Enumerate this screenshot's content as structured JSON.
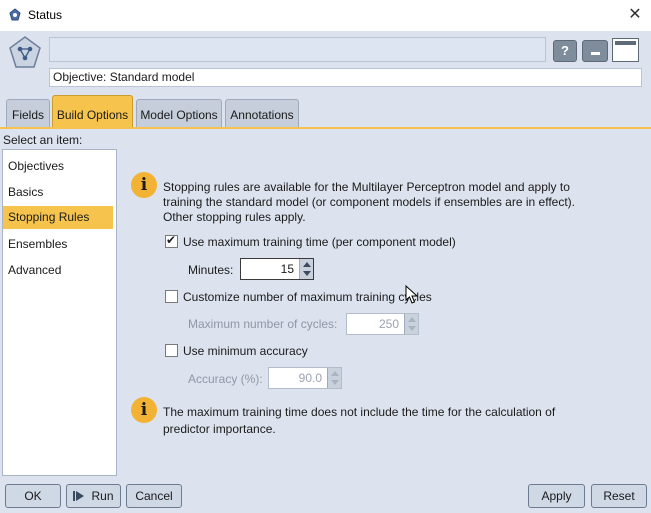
{
  "window": {
    "title": "Status",
    "close_glyph": "✕"
  },
  "header": {
    "name_value": "",
    "objective": "Objective: Standard model",
    "help_glyph": "?"
  },
  "tabs": [
    {
      "label": "Fields",
      "active": false
    },
    {
      "label": "Build Options",
      "active": true
    },
    {
      "label": "Model Options",
      "active": false
    },
    {
      "label": "Annotations",
      "active": false
    }
  ],
  "left_panel": {
    "label": "Select an item:",
    "items": [
      {
        "label": "Objectives",
        "selected": false
      },
      {
        "label": "Basics",
        "selected": false
      },
      {
        "label": "Stopping Rules",
        "selected": true
      },
      {
        "label": "Ensembles",
        "selected": false
      },
      {
        "label": "Advanced",
        "selected": false
      }
    ]
  },
  "stopping_rules": {
    "info_icon": "i",
    "info_line1": "Stopping rules are available for the Multilayer Perceptron model and apply to",
    "info_line2": "training the standard model (or component models if ensembles are in effect).",
    "info_line3": "Other stopping rules apply.",
    "use_max_time": {
      "label": "Use maximum training time (per component model)",
      "checked": true
    },
    "minutes": {
      "label": "Minutes:",
      "value": "15"
    },
    "customize_cycles": {
      "label": "Customize number of maximum training cycles",
      "checked": false
    },
    "max_cycles": {
      "label": "Maximum number of cycles:",
      "value": "250",
      "enabled": false
    },
    "use_min_accuracy": {
      "label": "Use minimum accuracy",
      "checked": false
    },
    "accuracy": {
      "label": "Accuracy (%):",
      "value": "90.0",
      "enabled": false
    },
    "note_line1": "The maximum training time does not include the time for the calculation of",
    "note_line2": "predictor importance."
  },
  "footer": {
    "ok_label": "OK",
    "run_label": "Run",
    "cancel_label": "Cancel",
    "apply_label": "Apply",
    "reset_label": "Reset"
  },
  "colors": {
    "accent": "#f6c44d",
    "panel_bg": "#dde3ee",
    "info_icon": "#f2b233"
  }
}
